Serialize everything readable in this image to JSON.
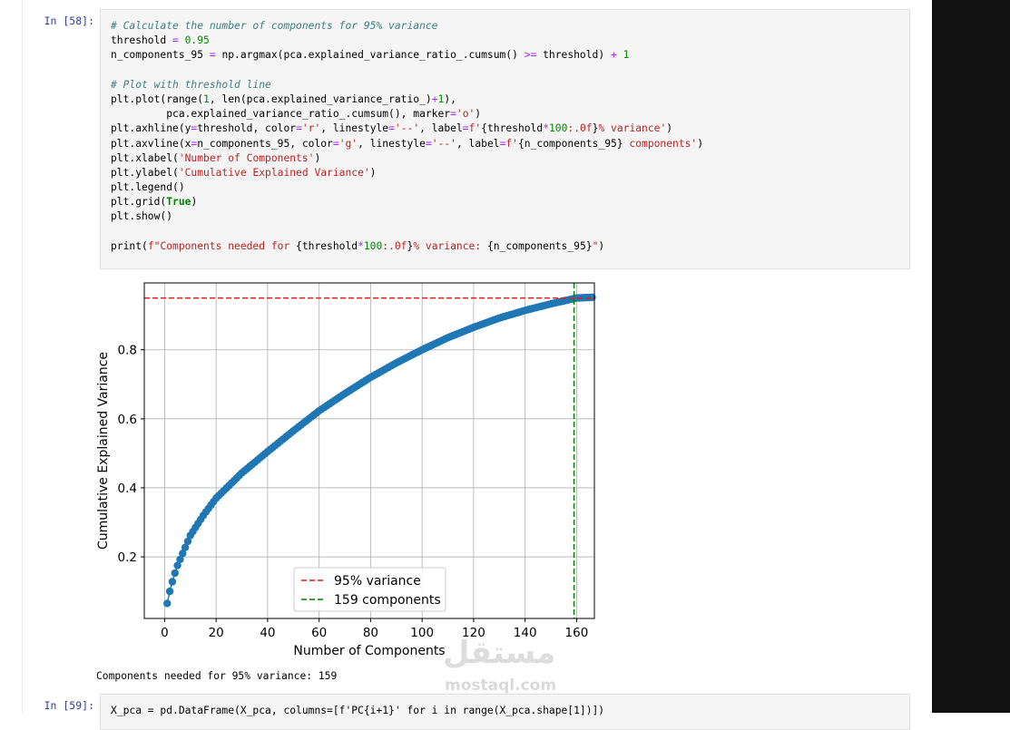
{
  "cell58": {
    "prompt": "In [58]:",
    "code": [
      [
        [
          "c-com",
          "# Calculate the number of components for 95% variance"
        ]
      ],
      [
        [
          "",
          "threshold "
        ],
        [
          "c-op",
          "="
        ],
        [
          "c-num",
          " 0.95"
        ]
      ],
      [
        [
          "",
          "n_components_95 "
        ],
        [
          "c-op",
          "="
        ],
        [
          "",
          "",
          " np.argmax(pca.explained_variance_ratio_.cumsum() "
        ],
        [
          "c-op",
          ">="
        ],
        [
          "",
          " threshold) "
        ],
        [
          "c-op",
          "+"
        ],
        [
          "c-num",
          " 1"
        ]
      ],
      [
        [
          "",
          ""
        ]
      ],
      [
        [
          "c-com",
          "# Plot with threshold line"
        ]
      ],
      [
        [
          "",
          "plt.plot(range("
        ],
        [
          "c-num",
          "1"
        ],
        [
          "",
          ", len(pca.explained_variance_ratio_)"
        ],
        [
          "c-op",
          "+"
        ],
        [
          "c-num",
          "1"
        ],
        [
          "",
          "),"
        ]
      ],
      [
        [
          "",
          "         pca.explained_variance_ratio_.cumsum(), marker"
        ],
        [
          "c-op",
          "="
        ],
        [
          "c-str",
          "'o'"
        ],
        [
          "",
          ")"
        ]
      ],
      [
        [
          "",
          "plt.axhline(y"
        ],
        [
          "c-op",
          "="
        ],
        [
          "",
          "threshold, color"
        ],
        [
          "c-op",
          "="
        ],
        [
          "c-str",
          "'r'"
        ],
        [
          "",
          ", linestyle"
        ],
        [
          "c-op",
          "="
        ],
        [
          "c-str",
          "'--'"
        ],
        [
          "",
          ", label"
        ],
        [
          "c-op",
          "="
        ],
        [
          "c-str",
          "f'"
        ],
        [
          "",
          "{threshold"
        ],
        [
          "c-op",
          "*"
        ],
        [
          "c-num",
          "100"
        ],
        [
          "c-str",
          ":.0f"
        ],
        [
          "",
          "}"
        ],
        [
          "c-str",
          "% variance'"
        ],
        [
          "",
          ")"
        ]
      ],
      [
        [
          "",
          "plt.axvline(x"
        ],
        [
          "c-op",
          "="
        ],
        [
          "",
          "n_components_95, color"
        ],
        [
          "c-op",
          "="
        ],
        [
          "c-str",
          "'g'"
        ],
        [
          "",
          ", linestyle"
        ],
        [
          "c-op",
          "="
        ],
        [
          "c-str",
          "'--'"
        ],
        [
          "",
          ", label"
        ],
        [
          "c-op",
          "="
        ],
        [
          "c-str",
          "f'"
        ],
        [
          "",
          "{n_components_95}"
        ],
        [
          "c-str",
          " components'"
        ],
        [
          "",
          ")"
        ]
      ],
      [
        [
          "",
          "plt.xlabel("
        ],
        [
          "c-str",
          "'Number of Components'"
        ],
        [
          "",
          ")"
        ]
      ],
      [
        [
          "",
          "plt.ylabel("
        ],
        [
          "c-str",
          "'Cumulative Explained Variance'"
        ],
        [
          "",
          ")"
        ]
      ],
      [
        [
          "",
          "plt.legend()"
        ]
      ],
      [
        [
          "",
          "plt.grid("
        ],
        [
          "c-kw",
          "True"
        ],
        [
          "",
          ")"
        ]
      ],
      [
        [
          "",
          "plt.show()"
        ]
      ],
      [
        [
          "",
          ""
        ]
      ],
      [
        [
          "",
          "print("
        ],
        [
          "c-str",
          "f\"Components needed for "
        ],
        [
          "",
          "{threshold"
        ],
        [
          "c-op",
          "*"
        ],
        [
          "c-num",
          "100"
        ],
        [
          "c-str",
          ":.0f"
        ],
        [
          "",
          "}"
        ],
        [
          "c-str",
          "% variance: "
        ],
        [
          "",
          "{n_components_95}"
        ],
        [
          "c-str",
          "\""
        ],
        [
          "",
          ")"
        ]
      ]
    ]
  },
  "output": {
    "stdout": "Components needed for 95% variance: 159"
  },
  "cell59": {
    "prompt": "In [59]:",
    "code_partial": "X_pca = pd.DataFrame(X_pca, columns=[f'PC{i+1}' for i in range(X_pca.shape[1])])"
  },
  "watermark": {
    "arabic": "مستقل",
    "latin": "mostaql.com"
  },
  "chart_data": {
    "type": "scatter",
    "marker": "o",
    "series_color": "#1f77b4",
    "xlabel": "Number of Components",
    "ylabel": "Cumulative Explained Variance",
    "xlim": [
      -7.9,
      166.9
    ],
    "ylim": [
      0.0215,
      0.9937
    ],
    "xticks": [
      0,
      20,
      40,
      60,
      80,
      100,
      120,
      140,
      160
    ],
    "yticks": [
      0.2,
      0.4,
      0.6,
      0.8
    ],
    "ytick_labels": [
      "0.2",
      "0.4",
      "0.6",
      "0.8"
    ],
    "grid": true,
    "n_points": 166,
    "curve_anchor_points": [
      [
        1,
        0.065
      ],
      [
        2,
        0.1
      ],
      [
        3,
        0.128
      ],
      [
        4,
        0.153
      ],
      [
        5,
        0.175
      ],
      [
        10,
        0.262
      ],
      [
        15,
        0.32
      ],
      [
        20,
        0.37
      ],
      [
        30,
        0.443
      ],
      [
        40,
        0.505
      ],
      [
        50,
        0.565
      ],
      [
        60,
        0.623
      ],
      [
        70,
        0.673
      ],
      [
        80,
        0.72
      ],
      [
        90,
        0.762
      ],
      [
        100,
        0.8
      ],
      [
        110,
        0.835
      ],
      [
        120,
        0.865
      ],
      [
        130,
        0.892
      ],
      [
        140,
        0.914
      ],
      [
        150,
        0.933
      ],
      [
        160,
        0.95
      ],
      [
        166,
        0.952
      ]
    ],
    "hline": {
      "y": 0.95,
      "color": "#e41a1c",
      "label": "95% variance"
    },
    "vline": {
      "x": 159,
      "color": "#008000",
      "label": "159 components"
    },
    "legend_position": "lower center"
  }
}
